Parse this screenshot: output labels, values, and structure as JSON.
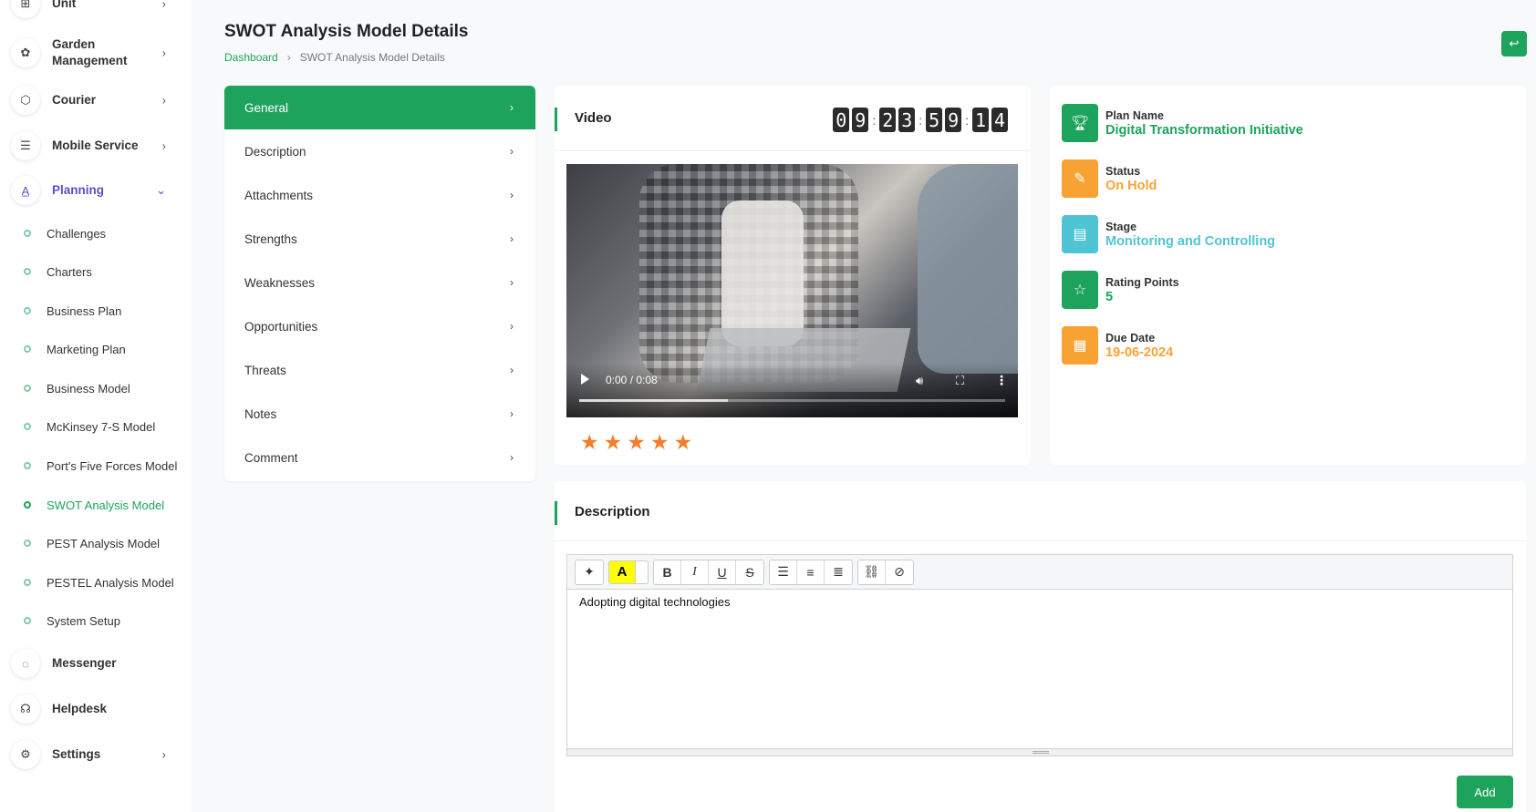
{
  "sidebar": {
    "top_partial": "Unit",
    "items": [
      {
        "label": "Garden Management",
        "icon": "flower-icon"
      },
      {
        "label": "Courier",
        "icon": "box-icon"
      },
      {
        "label": "Mobile Service",
        "icon": "menu-icon"
      },
      {
        "label": "Planning",
        "icon": "planning-icon"
      },
      {
        "label": "Messenger",
        "icon": "chat-icon"
      },
      {
        "label": "Helpdesk",
        "icon": "headset-icon"
      },
      {
        "label": "Settings",
        "icon": "gear-icon"
      }
    ],
    "planning_sub": [
      "Challenges",
      "Charters",
      "Business Plan",
      "Marketing Plan",
      "Business Model",
      "McKinsey 7-S Model",
      "Port's Five Forces Model",
      "SWOT Analysis Model",
      "PEST Analysis Model",
      "PESTEL Analysis Model",
      "System Setup"
    ],
    "active_sub": "SWOT Analysis Model"
  },
  "header": {
    "title": "SWOT Analysis Model Details",
    "breadcrumb_home": "Dashboard",
    "breadcrumb_current": "SWOT Analysis Model Details"
  },
  "menu": [
    "General",
    "Description",
    "Attachments",
    "Strengths",
    "Weaknesses",
    "Opportunities",
    "Threats",
    "Notes",
    "Comment"
  ],
  "video_card": {
    "title": "Video",
    "timer": [
      "0",
      "9",
      "2",
      "3",
      "5",
      "9",
      "1",
      "4"
    ],
    "time_display": "0:00 / 0:08",
    "progress": 0.35,
    "rating": 5
  },
  "info": [
    {
      "label": "Plan Name",
      "value": "Digital Transformation Initiative",
      "color": "#1ea35d",
      "icon": "trophy-icon"
    },
    {
      "label": "Status",
      "value": "On Hold",
      "color": "#f8a234",
      "icon": "edit-icon"
    },
    {
      "label": "Stage",
      "value": "Monitoring and Controlling",
      "color": "#4fc4d4",
      "icon": "server-icon"
    },
    {
      "label": "Rating Points",
      "value": "5",
      "color": "#1ea35d",
      "icon": "star-icon"
    },
    {
      "label": "Due Date",
      "value": "19-06-2024",
      "color": "#f8a234",
      "icon": "calendar-icon"
    }
  ],
  "description": {
    "title": "Description",
    "content": "Adopting digital technologies",
    "add_label": "Add"
  },
  "colors": {
    "accent": "#1ea35d",
    "planning": "#5b4fc4",
    "star": "#f47e2a"
  }
}
